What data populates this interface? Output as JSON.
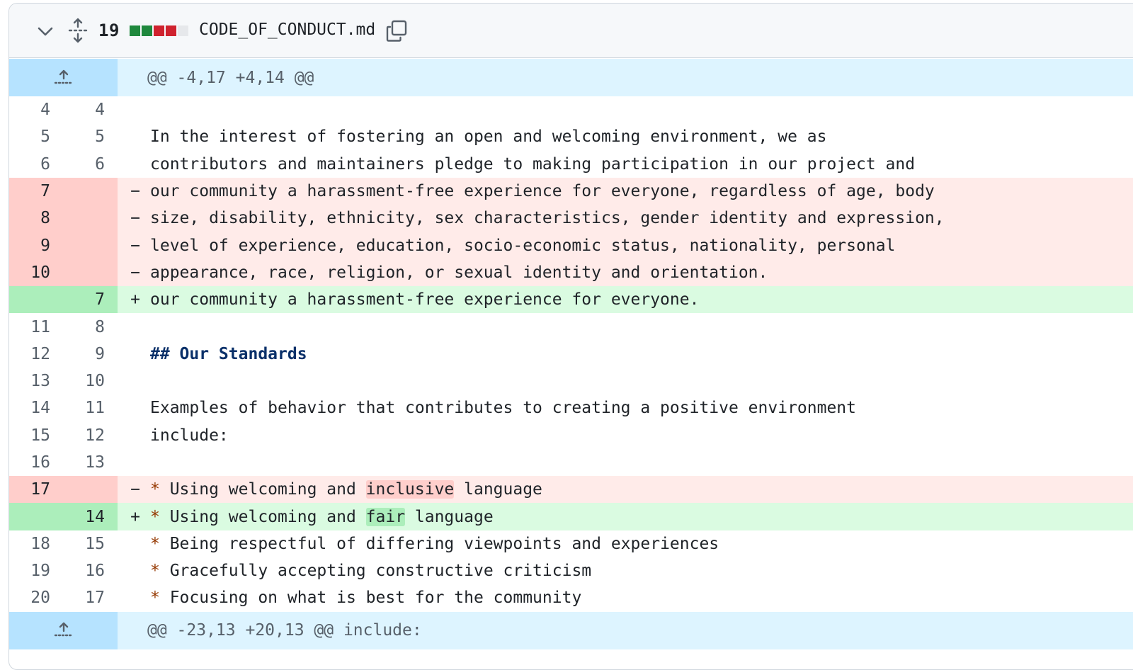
{
  "file_header": {
    "changes_count": "19",
    "file_name": "CODE_OF_CONDUCT.md",
    "diffstat_colors": [
      "#1f883d",
      "#1f883d",
      "#cf222e",
      "#cf222e",
      "#e6e8eb"
    ]
  },
  "hunks": [
    {
      "header": "@@ -4,17 +4,14 @@"
    },
    {
      "header": "@@ -23,13 +20,13 @@ include:"
    }
  ],
  "lines": [
    {
      "old": "4",
      "new": "4",
      "marker": "",
      "text": ""
    },
    {
      "old": "5",
      "new": "5",
      "marker": "",
      "text": "In the interest of fostering an open and welcoming environment, we as"
    },
    {
      "old": "6",
      "new": "6",
      "marker": "",
      "text": "contributors and maintainers pledge to making participation in our project and"
    },
    {
      "old": "7",
      "new": "",
      "marker": "−",
      "text": "our community a harassment-free experience for everyone, regardless of age, body"
    },
    {
      "old": "8",
      "new": "",
      "marker": "−",
      "text": "size, disability, ethnicity, sex characteristics, gender identity and expression,"
    },
    {
      "old": "9",
      "new": "",
      "marker": "−",
      "text": "level of experience, education, socio-economic status, nationality, personal"
    },
    {
      "old": "10",
      "new": "",
      "marker": "−",
      "text": "appearance, race, religion, or sexual identity and orientation."
    },
    {
      "old": "",
      "new": "7",
      "marker": "+",
      "text": "our community a harassment-free experience for everyone."
    },
    {
      "old": "11",
      "new": "8",
      "marker": "",
      "text": ""
    },
    {
      "old": "12",
      "new": "9",
      "marker": "",
      "text": "## Our Standards"
    },
    {
      "old": "13",
      "new": "10",
      "marker": "",
      "text": ""
    },
    {
      "old": "14",
      "new": "11",
      "marker": "",
      "text": "Examples of behavior that contributes to creating a positive environment"
    },
    {
      "old": "15",
      "new": "12",
      "marker": "",
      "text": "include:"
    },
    {
      "old": "16",
      "new": "13",
      "marker": "",
      "text": ""
    },
    {
      "old": "17",
      "new": "",
      "marker": "−",
      "bullet": "*",
      "pre": " Using welcoming and ",
      "hl": "inclusive",
      "post": " language"
    },
    {
      "old": "",
      "new": "14",
      "marker": "+",
      "bullet": "*",
      "pre": " Using welcoming and ",
      "hl": "fair",
      "post": " language"
    },
    {
      "old": "18",
      "new": "15",
      "marker": "",
      "bullet": "*",
      "text": " Being respectful of differing viewpoints and experiences"
    },
    {
      "old": "19",
      "new": "16",
      "marker": "",
      "bullet": "*",
      "text": " Gracefully accepting constructive criticism"
    },
    {
      "old": "20",
      "new": "17",
      "marker": "",
      "bullet": "*",
      "text": " Focusing on what is best for the community"
    }
  ]
}
